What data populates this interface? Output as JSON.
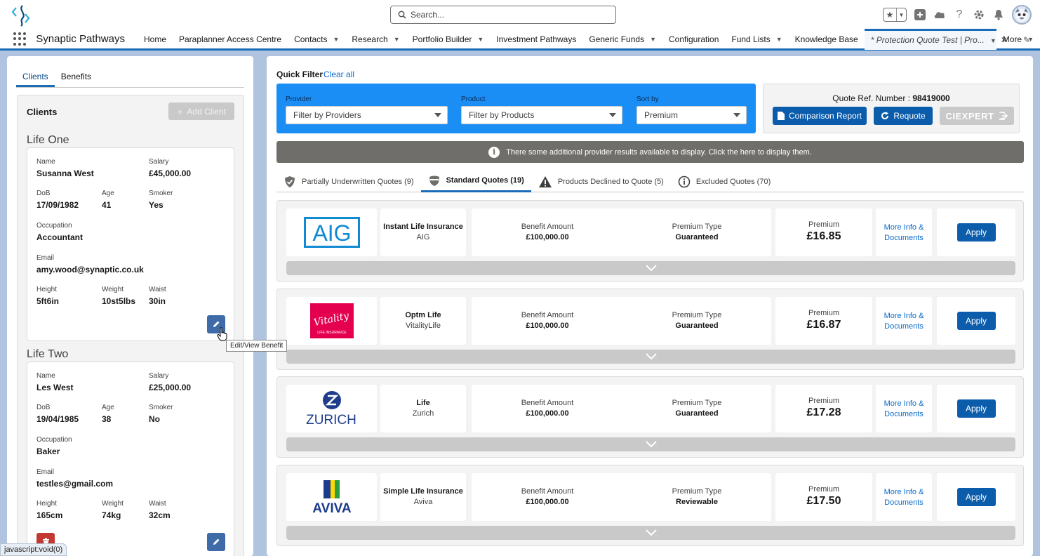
{
  "header": {
    "search_placeholder": "Search..."
  },
  "nav": {
    "app_name": "Synaptic Pathways",
    "items": [
      {
        "label": "Home",
        "dropdown": false
      },
      {
        "label": "Paraplanner Access Centre",
        "dropdown": false
      },
      {
        "label": "Contacts",
        "dropdown": true
      },
      {
        "label": "Research",
        "dropdown": true
      },
      {
        "label": "Portfolio Builder",
        "dropdown": true
      },
      {
        "label": "Investment Pathways",
        "dropdown": false
      },
      {
        "label": "Generic Funds",
        "dropdown": true
      },
      {
        "label": "Configuration",
        "dropdown": false
      },
      {
        "label": "Fund Lists",
        "dropdown": true
      },
      {
        "label": "Knowledge Base",
        "dropdown": false
      }
    ],
    "active_tab": "* Protection Quote Test | Pro...",
    "more_label": "More"
  },
  "left": {
    "tabs": [
      "Clients",
      "Benefits"
    ],
    "clients_title": "Clients",
    "add_client": "Add Client",
    "labels": {
      "name": "Name",
      "salary": "Salary",
      "dob": "DoB",
      "age": "Age",
      "smoker": "Smoker",
      "occupation": "Occupation",
      "email": "Email",
      "height": "Height",
      "weight": "Weight",
      "waist": "Waist"
    },
    "life_one": {
      "heading": "Life One",
      "name": "Susanna West",
      "salary": "£45,000.00",
      "dob": "17/09/1982",
      "age": "41",
      "smoker": "Yes",
      "occupation": "Accountant",
      "email": "amy.wood@synaptic.co.uk",
      "height": "5ft6in",
      "weight": "10st5lbs",
      "waist": "30in"
    },
    "life_two": {
      "heading": "Life Two",
      "name": "Les West",
      "salary": "£25,000.00",
      "dob": "19/04/1985",
      "age": "38",
      "smoker": "No",
      "occupation": "Baker",
      "email": "testles@gmail.com",
      "height": "165cm",
      "weight": "74kg",
      "waist": "32cm"
    },
    "tooltip": "Edit/View Benefit"
  },
  "status_bar": "javascript:void(0)",
  "filters": {
    "quick_filter": "Quick Filter",
    "clear_all": "Clear all",
    "provider_label": "Provider",
    "provider_placeholder": "Filter by Providers",
    "product_label": "Product",
    "product_placeholder": "Filter by Products",
    "sort_label": "Sort by",
    "sort_value": "Premium"
  },
  "quote_ref": {
    "label": "Quote Ref. Number :",
    "number": "98419000",
    "comparison_report": "Comparison Report",
    "requote": "Requote",
    "ciexpert": "CIEXPERT"
  },
  "banner": "There some additional provider results available to display. Click the here to display them.",
  "quote_tabs": [
    {
      "label": "Partially Underwritten Quotes (9)",
      "icon": "shield-check-icon",
      "active": false
    },
    {
      "label": "Standard Quotes (19)",
      "icon": "shield-icon",
      "active": true
    },
    {
      "label": "Products Declined to Quote (5)",
      "icon": "warning-icon",
      "active": false
    },
    {
      "label": "Excluded Quotes (70)",
      "icon": "info-icon",
      "active": false
    }
  ],
  "quote_labels": {
    "benefit_amount": "Benefit Amount",
    "premium_type": "Premium Type",
    "premium": "Premium",
    "more_info": "More Info &",
    "documents": "Documents",
    "apply": "Apply"
  },
  "quotes": [
    {
      "product": "Instant Life Insurance",
      "provider": "AIG",
      "logo": "AIG",
      "benefit": "£100,000.00",
      "premium_type": "Guaranteed",
      "premium": "£16.85"
    },
    {
      "product": "Optm Life",
      "provider": "VitalityLife",
      "logo": "Vitality",
      "logo_sub": "LIFE INSURANCE",
      "benefit": "£100,000.00",
      "premium_type": "Guaranteed",
      "premium": "£16.87"
    },
    {
      "product": "Life",
      "provider": "Zurich",
      "logo": "ZURICH",
      "benefit": "£100,000.00",
      "premium_type": "Guaranteed",
      "premium": "£17.28"
    },
    {
      "product": "Simple Life Insurance",
      "provider": "Aviva",
      "logo": "AVIVA",
      "benefit": "£100,000.00",
      "premium_type": "Reviewable",
      "premium": "£17.50"
    }
  ],
  "colors": {
    "brand_blue": "#0b5cab",
    "filter_blue": "#1b8ef5",
    "aig_blue": "#0f8ad3",
    "vitality_pink": "#e5004f",
    "zurich_blue": "#1f3d8a",
    "aviva_blue": "#1d3b8c",
    "aviva_yellow": "#fcd900",
    "aviva_green": "#2d9e40"
  }
}
